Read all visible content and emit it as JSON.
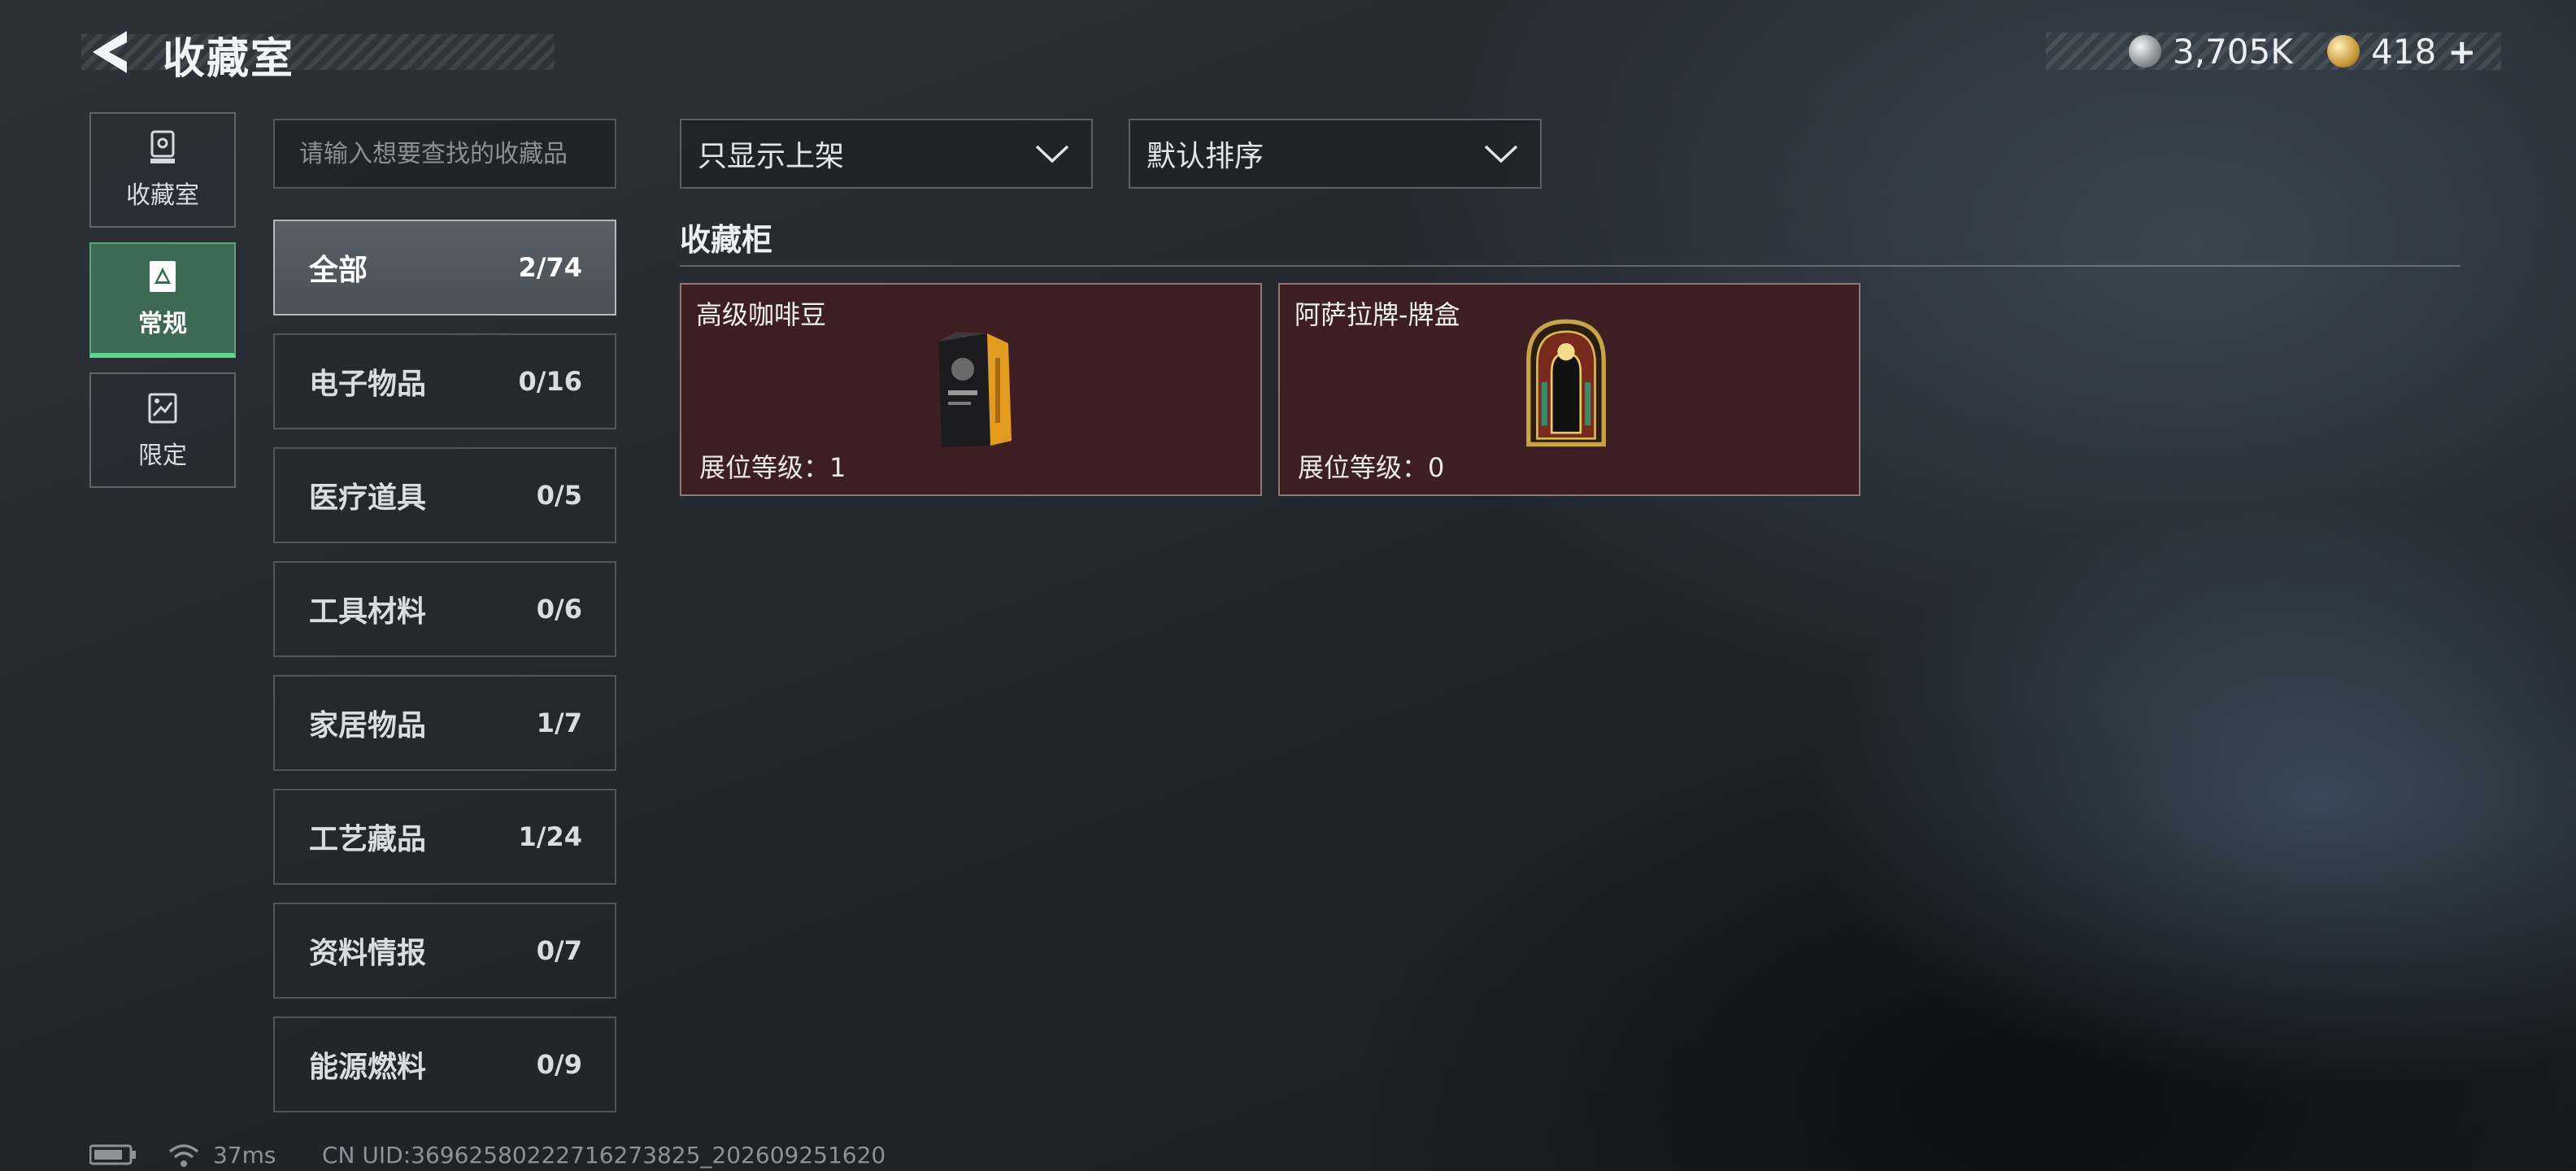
{
  "header": {
    "title": "收藏室",
    "currencies": [
      {
        "icon": "silver-coin-icon",
        "value": "3,705K"
      },
      {
        "icon": "gold-coin-icon",
        "value": "418",
        "suffix": "+"
      }
    ]
  },
  "nav": {
    "items": [
      {
        "label": "收藏室",
        "icon": "trophy-icon",
        "active": false
      },
      {
        "label": "常规",
        "icon": "card-icon",
        "active": true
      },
      {
        "label": "限定",
        "icon": "limited-icon",
        "active": false
      }
    ]
  },
  "search": {
    "placeholder": "请输入想要查找的收藏品",
    "value": ""
  },
  "categories": [
    {
      "name": "全部",
      "count": "2/74",
      "active": true
    },
    {
      "name": "电子物品",
      "count": "0/16"
    },
    {
      "name": "医疗道具",
      "count": "0/5"
    },
    {
      "name": "工具材料",
      "count": "0/6"
    },
    {
      "name": "家居物品",
      "count": "1/7"
    },
    {
      "name": "工艺藏品",
      "count": "1/24"
    },
    {
      "name": "资料情报",
      "count": "0/7"
    },
    {
      "name": "能源燃料",
      "count": "0/9"
    }
  ],
  "filters": {
    "display": {
      "value": "只显示上架"
    },
    "sort": {
      "value": "默认排序"
    }
  },
  "section": {
    "title": "收藏柜"
  },
  "items": [
    {
      "name": "高级咖啡豆",
      "level": "展位等级：1",
      "icon": "coffee-bag-icon"
    },
    {
      "name": "阿萨拉牌-牌盒",
      "level": "展位等级：0",
      "icon": "card-box-icon"
    }
  ],
  "status": {
    "ping": "37ms",
    "uid": "CN UID:36962580222716273825_202609251620"
  },
  "colors": {
    "accent_green": "#5fd391",
    "card_bg": "#3d1f23"
  }
}
